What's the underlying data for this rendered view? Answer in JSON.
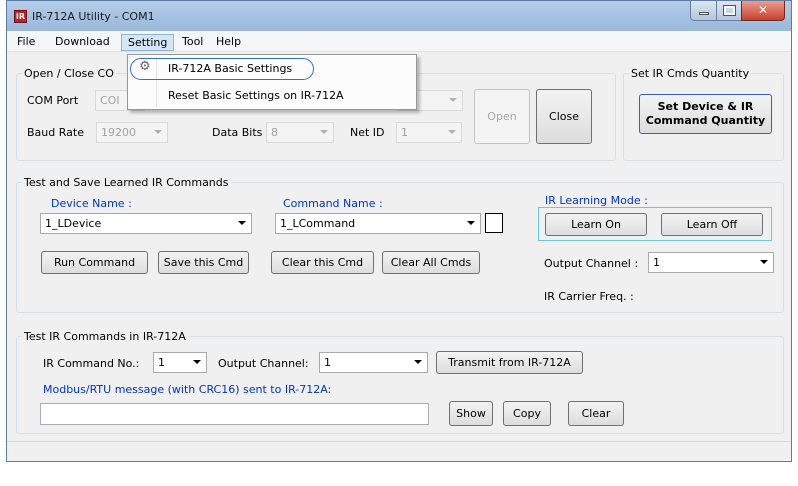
{
  "window": {
    "title": "IR-712A Utility - COM1",
    "app_icon_glyph": "IR"
  },
  "menu": {
    "items": [
      "File",
      "Download",
      "Setting",
      "Tool",
      "Help"
    ],
    "dropdown": [
      "IR-712A Basic Settings",
      "Reset Basic Settings on IR-712A"
    ]
  },
  "com_group": {
    "legend": "Open / Close CO",
    "com_port_label": "COM Port",
    "com_port_value": "COI",
    "baud_label": "Baud Rate",
    "baud_value": "19200",
    "data_bits_label": "Data Bits",
    "data_bits_value": "8",
    "net_id_label": "Net ID",
    "net_id_value": "1",
    "open_label": "Open",
    "close_label": "Close"
  },
  "quantity_group": {
    "legend": "Set IR Cmds Quantity",
    "button_line1": "Set Device & IR",
    "button_line2": "Command Quantity"
  },
  "learned_group": {
    "legend": "Test and Save Learned IR Commands",
    "device_name_label": "Device Name :",
    "device_name_value": "1_LDevice",
    "command_name_label": "Command Name :",
    "command_name_value": "1_LCommand",
    "run_label": "Run Command",
    "save_label": "Save this Cmd",
    "clear_cmd_label": "Clear this Cmd",
    "clear_all_label": "Clear All Cmds",
    "learning_mode_label": "IR Learning Mode :",
    "learn_on_label": "Learn On",
    "learn_off_label": "Learn Off",
    "output_channel_label": "Output Channel :",
    "output_channel_value": "1",
    "carrier_label": "IR Carrier Freq. :"
  },
  "test_group": {
    "legend": "Test IR Commands in IR-712A",
    "cmd_no_label": "IR Command No.:",
    "cmd_no_value": "1",
    "output_channel_label": "Output Channel:",
    "output_channel_value": "1",
    "transmit_label": "Transmit from IR-712A",
    "modbus_label": "Modbus/RTU message (with CRC16) sent to IR-712A:",
    "modbus_value": "",
    "show_label": "Show",
    "copy_label": "Copy",
    "clear_label": "Clear"
  },
  "colors": {
    "accent_blue": "#0033cc",
    "titlebar": "#b4cce7",
    "close_red": "#c9402b",
    "highlight_ring": "#2b6fd8"
  }
}
